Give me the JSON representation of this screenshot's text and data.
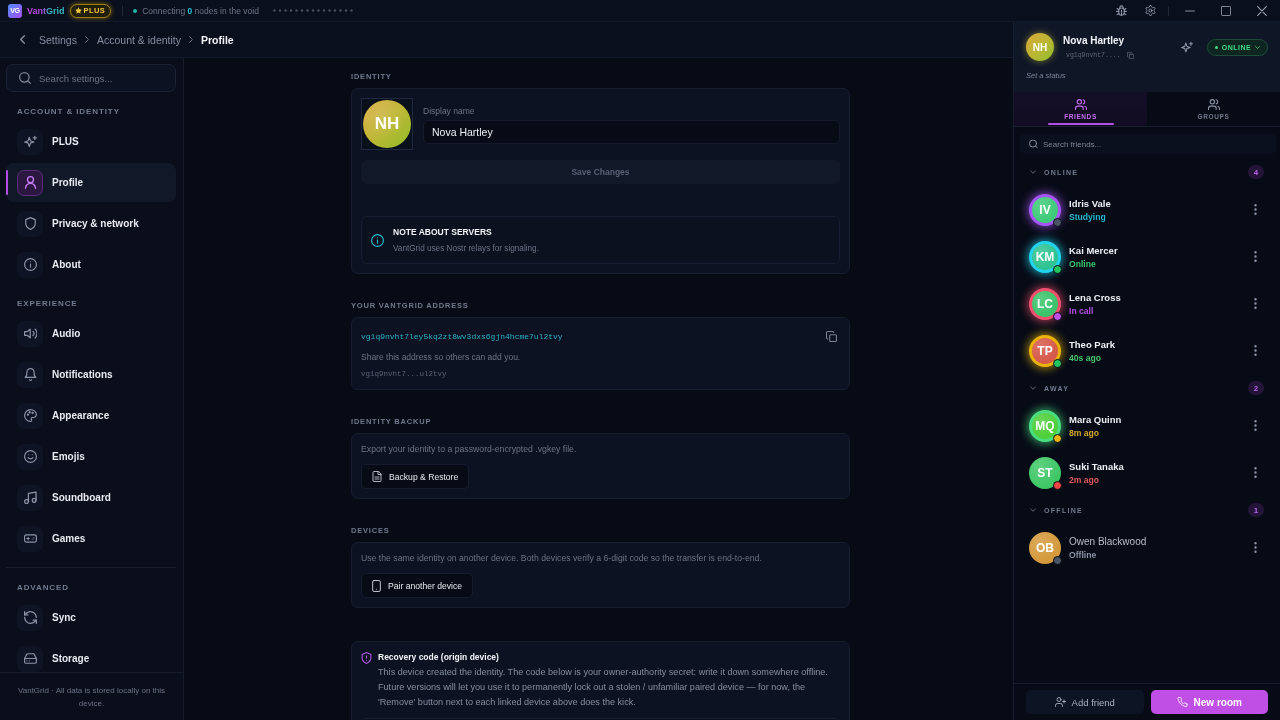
{
  "titlebar": {
    "logo": "VG",
    "app_name": "VantGrid",
    "badge": "PLUS",
    "status": "Connecting **0** nodes in the void"
  },
  "breadcrumb": [
    {
      "label": "Settings",
      "current": false
    },
    {
      "label": "Account & identity",
      "current": false
    },
    {
      "label": "Profile",
      "current": true
    }
  ],
  "sidebar": {
    "search": {
      "placeholder": "Search settings..."
    },
    "sections": [
      {
        "title": "ACCOUNT & IDENTITY",
        "separated": false,
        "items": [
          {
            "label": "PLUS",
            "selected": false
          },
          {
            "label": "Profile",
            "selected": true
          },
          {
            "label": "Privacy & network",
            "selected": false
          },
          {
            "label": "About",
            "selected": false
          }
        ]
      },
      {
        "title": "EXPERIENCE",
        "separated": false,
        "items": [
          {
            "label": "Audio",
            "selected": false
          },
          {
            "label": "Notifications",
            "selected": false
          },
          {
            "label": "Appearance",
            "selected": false
          },
          {
            "label": "Emojis",
            "selected": false
          },
          {
            "label": "Soundboard",
            "selected": false
          },
          {
            "label": "Games",
            "selected": false
          }
        ]
      },
      {
        "title": "ADVANCED",
        "separated": true,
        "items": [
          {
            "label": "Sync",
            "selected": false
          },
          {
            "label": "Storage",
            "selected": false
          }
        ]
      }
    ],
    "footer": "VantGrid · All data is stored locally on this device."
  },
  "identity": {
    "title": "IDENTITY",
    "avatar": "NH",
    "field_label": "Display name",
    "field_value": "Nova Hartley",
    "save_button": {
      "label": "Save Changes",
      "disabled": true
    },
    "note": {
      "title": "NOTE ABOUT SERVERS",
      "text": "VantGrid uses Nostr relays for signaling."
    }
  },
  "address": {
    "title": "YOUR VANTGRID ADDRESS",
    "value": "vg1q9nvht7ley5kq2zt8wv3dxs6gjn4hcme7ul2tvy",
    "hint": "Share this address so others can add you.",
    "short": "vg1q9nvht7...ul2tvy"
  },
  "backup": {
    "title": "IDENTITY BACKUP",
    "text": "Export your identity to a password-encrypted .vgkey file.",
    "button": "Backup & Restore"
  },
  "devices": {
    "title": "DEVICES",
    "text": "Use the same identity on another device. Both devices verify a 6-digit code so the transfer is end-to-end.",
    "button": "Pair another device"
  },
  "recovery": {
    "title": "Recovery code (origin device)",
    "text": "This device created the identity. The code below is your owner-authority secret: write it down somewhere offline. Future versions will let you use it to permanently lock out a stolen / unfamiliar paired device — for now, the 'Remove' button next to each linked device above does the kick."
  },
  "panel": {
    "profile": {
      "avatar": "NH",
      "name": "Nova Hartley",
      "address": "vg1q9nvht7....",
      "status_prompt": "Set a status",
      "presence": "ONLINE"
    },
    "tabs": [
      {
        "label": "FRIENDS",
        "selected": true
      },
      {
        "label": "GROUPS",
        "selected": false
      }
    ],
    "search": {
      "placeholder": "Search friends..."
    },
    "groups": [
      {
        "title": "ONLINE",
        "count": "4",
        "expanded": true,
        "friends": [
          {
            "name": "Idris Vale",
            "dimmed": false,
            "avatar": {
              "initials": "IV",
              "color": "#3ecb78"
            },
            "glow": {
              "color": "#a855f7"
            },
            "presence": {
              "color": "#4b5563"
            },
            "status": {
              "text": "Studying",
              "color": "#22b8cf"
            }
          },
          {
            "name": "Kai Mercer",
            "dimmed": false,
            "avatar": {
              "initials": "KM",
              "color": "#2fc391"
            },
            "glow": {
              "color": "#22d3ee"
            },
            "presence": {
              "color": "#22c55e"
            },
            "status": {
              "text": "Online",
              "color": "#34c46a"
            }
          },
          {
            "name": "Lena Cross",
            "dimmed": false,
            "avatar": {
              "initials": "LC",
              "color": "#3cc36b"
            },
            "glow": {
              "color": "#f0506e"
            },
            "presence": {
              "color": "#c04fe6"
            },
            "status": {
              "text": "In call",
              "color": "#b44fe6"
            }
          },
          {
            "name": "Theo Park",
            "dimmed": false,
            "avatar": {
              "initials": "TP",
              "color": "#d65a4a"
            },
            "glow": {
              "color": "#eab308"
            },
            "presence": {
              "color": "#22c55e"
            },
            "status": {
              "text": "40s ago",
              "color": "#46c46a"
            }
          }
        ]
      },
      {
        "title": "AWAY",
        "count": "2",
        "expanded": true,
        "friends": [
          {
            "name": "Mara Quinn",
            "dimmed": false,
            "avatar": {
              "initials": "MQ",
              "color": "#4fcf3a"
            },
            "glow": {
              "color": "#4ade80"
            },
            "presence": {
              "color": "#eab308"
            },
            "status": {
              "text": "8m ago",
              "color": "#d4a72c"
            }
          },
          {
            "name": "Suki Tanaka",
            "dimmed": false,
            "avatar": {
              "initials": "ST",
              "color": "#3fc766"
            },
            "presence": {
              "color": "#ef4444"
            },
            "status": {
              "text": "2m ago",
              "color": "#e0575b"
            }
          }
        ]
      },
      {
        "title": "OFFLINE",
        "count": "1",
        "expanded": true,
        "friends": [
          {
            "name": "Owen Blackwood",
            "dimmed": true,
            "avatar": {
              "initials": "OB",
              "color": "#d49a3c"
            },
            "presence": {
              "color": "#4b5563"
            },
            "status": {
              "text": "Offline",
              "color": "#8a92a3"
            }
          }
        ]
      }
    ],
    "actions": [
      {
        "label": "Add friend",
        "kind": "secondary"
      },
      {
        "label": "New room",
        "kind": "primary"
      }
    ]
  }
}
